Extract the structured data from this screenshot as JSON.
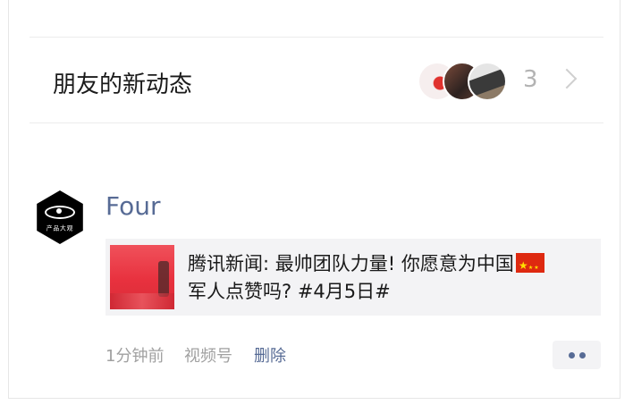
{
  "friends_updates": {
    "label": "朋友的新动态",
    "count": "3",
    "avatars": [
      "friend-avatar",
      "friend-avatar",
      "friend-avatar"
    ]
  },
  "post": {
    "author": "Four",
    "avatar_caption": "产品大观",
    "share_title": "腾讯新闻: 最帅团队力量! 你愿意为中国",
    "share_title_cont": "军人点赞吗? #4月5日#",
    "time": "1分钟前",
    "source": "视频号",
    "delete_label": "删除"
  },
  "colors": {
    "link_blue": "#576b95",
    "meta_gray": "#a0a0a0",
    "card_bg": "#f3f3f5"
  },
  "icons": {
    "chevron": "chevron-right-icon",
    "flag": "china-flag-icon",
    "more": "more-dots-icon"
  }
}
